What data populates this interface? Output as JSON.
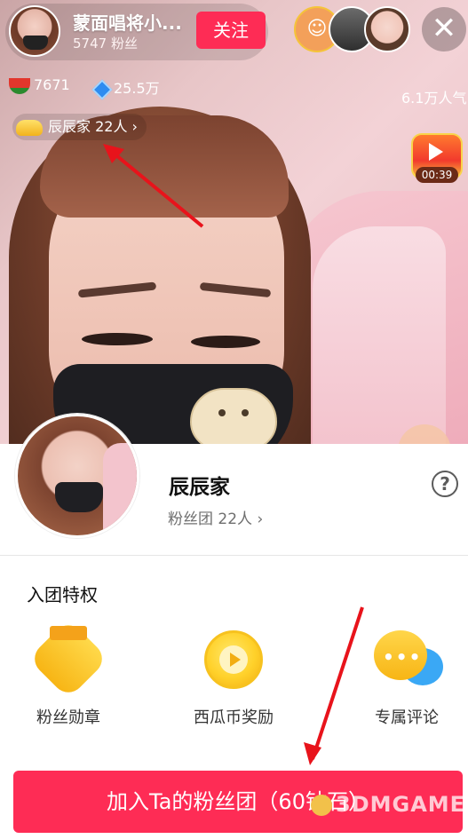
{
  "stream": {
    "host_name": "蒙面唱将小...",
    "host_fans": "5747 粉丝",
    "follow_label": "关注",
    "close_glyph": "✕",
    "melon_count": "7671",
    "diamond_count": "25.5万",
    "popularity": "6.1万人气",
    "fan_tag": "辰辰家 22人 ›",
    "treasure_timer": "00:39",
    "viewers": [
      "viewer-1",
      "viewer-2",
      "viewer-3"
    ]
  },
  "panel": {
    "club_name": "辰辰家",
    "club_count": "粉丝团 22人 ›",
    "help_glyph": "?",
    "section_title": "入团特权",
    "perks": [
      {
        "label": "粉丝勋章",
        "icon": "badge-icon"
      },
      {
        "label": "西瓜币奖励",
        "icon": "coin-icon"
      },
      {
        "label": "专属评论",
        "icon": "comment-icon"
      }
    ],
    "join_button": "加入Ta的粉丝团（60钻石）"
  },
  "watermark": "3DMGAME",
  "colors": {
    "accent": "#fe2c55",
    "annotation_arrow": "#e8131b",
    "gold": "#f7b515",
    "blue": "#3aa8f5"
  }
}
